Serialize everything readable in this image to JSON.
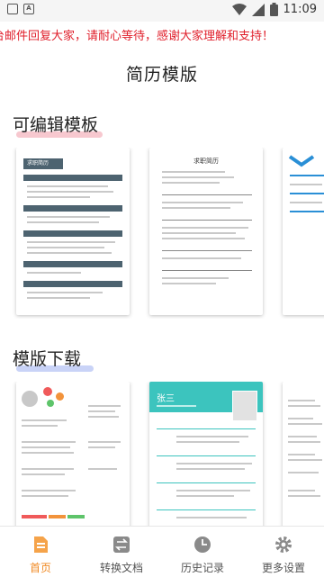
{
  "status_bar": {
    "time": "11:09",
    "left_icons": [
      "notification-icon",
      "a-badge-icon"
    ],
    "right_icons": [
      "wifi-icon",
      "signal-icon",
      "battery-icon"
    ]
  },
  "notice": {
    "text": "台邮件回复大家，请耐心等待，感谢大家理解和支持！",
    "color": "#e0202c"
  },
  "header": {
    "title": "简历模版"
  },
  "sections": {
    "editable": {
      "title": "可编辑模板",
      "highlight_color": "#f7c8cf"
    },
    "download": {
      "title": "模版下载",
      "highlight_color": "#c9d3f7"
    }
  },
  "editable_templates": [
    {
      "title": "求职简历",
      "theme": "dark-slate-banner",
      "color": "#4d6370"
    },
    {
      "title": "求职简历",
      "theme": "minimal-gray",
      "color": "#888888"
    },
    {
      "title": "",
      "theme": "blue-accent",
      "color": "#2a8fd6"
    }
  ],
  "download_templates": [
    {
      "title": "",
      "theme": "avatar-circles",
      "color": "#f2933b"
    },
    {
      "title": "张三",
      "theme": "teal-header",
      "color": "#3cc4be"
    },
    {
      "title": "",
      "theme": "plain-list",
      "color": "#999999"
    }
  ],
  "tab_bar": {
    "active_color": "#f08a24",
    "tabs": [
      {
        "label": "首页",
        "icon": "document-icon",
        "active": true
      },
      {
        "label": "转换文档",
        "icon": "convert-icon",
        "active": false
      },
      {
        "label": "历史记录",
        "icon": "clock-icon",
        "active": false
      },
      {
        "label": "更多设置",
        "icon": "gear-icon",
        "active": false
      }
    ]
  }
}
